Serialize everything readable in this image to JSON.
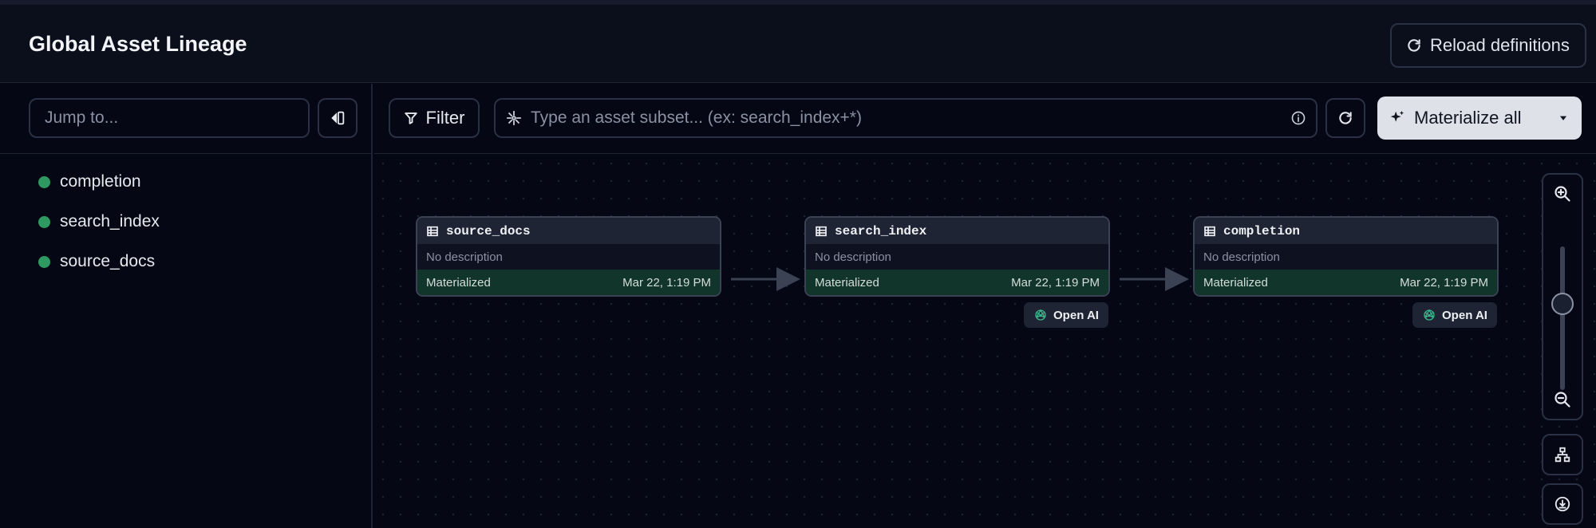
{
  "header": {
    "title": "Global Asset Lineage",
    "reload_label": "Reload definitions"
  },
  "sidebar": {
    "jump_placeholder": "Jump to...",
    "assets": [
      {
        "name": "completion",
        "status_color": "#2e9a62"
      },
      {
        "name": "search_index",
        "status_color": "#2e9a62"
      },
      {
        "name": "source_docs",
        "status_color": "#2e9a62"
      }
    ]
  },
  "toolbar": {
    "filter_label": "Filter",
    "subset_placeholder": "Type an asset subset... (ex: search_index+*)",
    "materialize_label": "Materialize all"
  },
  "graph": {
    "nodes": [
      {
        "name": "source_docs",
        "description": "No description",
        "status": "Materialized",
        "timestamp": "Mar 22, 1:19 PM",
        "kind": ""
      },
      {
        "name": "search_index",
        "description": "No description",
        "status": "Materialized",
        "timestamp": "Mar 22, 1:19 PM",
        "kind": "Open AI"
      },
      {
        "name": "completion",
        "description": "No description",
        "status": "Materialized",
        "timestamp": "Mar 22, 1:19 PM",
        "kind": "Open AI"
      }
    ],
    "zoom_level": 0.6
  },
  "colors": {
    "materialized": "#11352b",
    "status_dot": "#2e9a62",
    "accent_button": "#dfe1e8"
  }
}
